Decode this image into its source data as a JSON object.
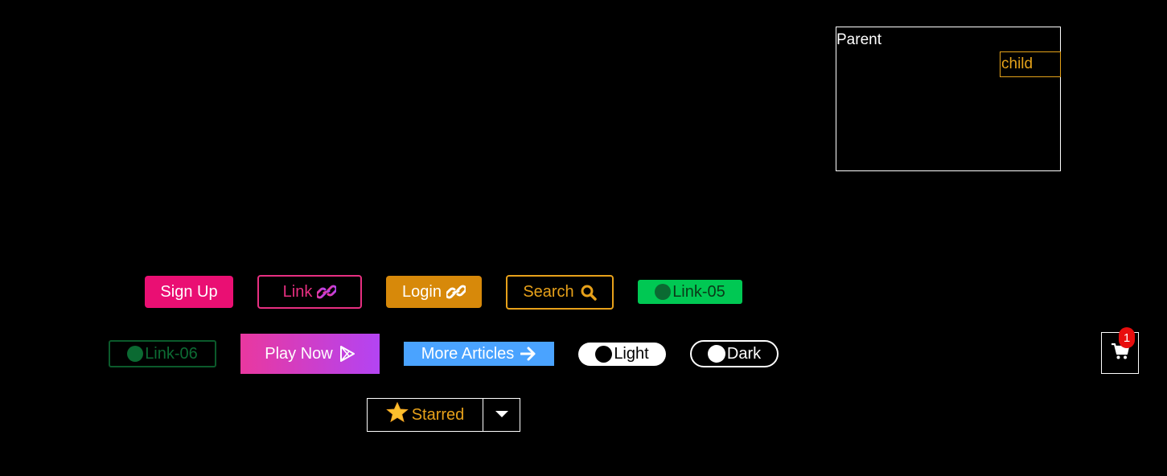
{
  "demo": {
    "parent_label": "Parent",
    "child_label": "child"
  },
  "buttons": {
    "signup": "Sign Up",
    "link": "Link",
    "login": "Login",
    "search": "Search",
    "link05": "Link-05",
    "link06": "Link-06",
    "play": "Play Now",
    "more": "More Articles",
    "light": "Light",
    "dark": "Dark",
    "starred": "Starred"
  },
  "cart": {
    "count": "1"
  },
  "icons": {
    "link": "link-icon",
    "search": "search-icon",
    "play": "play-store-icon",
    "arrow": "arrow-right-icon",
    "star": "star-icon",
    "caret": "caret-down-icon",
    "cart": "shopping-cart-icon"
  },
  "colors": {
    "background": "#000000",
    "pink": "#ea0f73",
    "orange": "#d7890a",
    "amber": "#e7a11a",
    "green": "#00c853",
    "dark_green": "#0b6a32",
    "blue": "#4aa3ff",
    "badge_red": "#e80d0d",
    "gradient_start": "#e9389f",
    "gradient_end": "#b344f3"
  }
}
